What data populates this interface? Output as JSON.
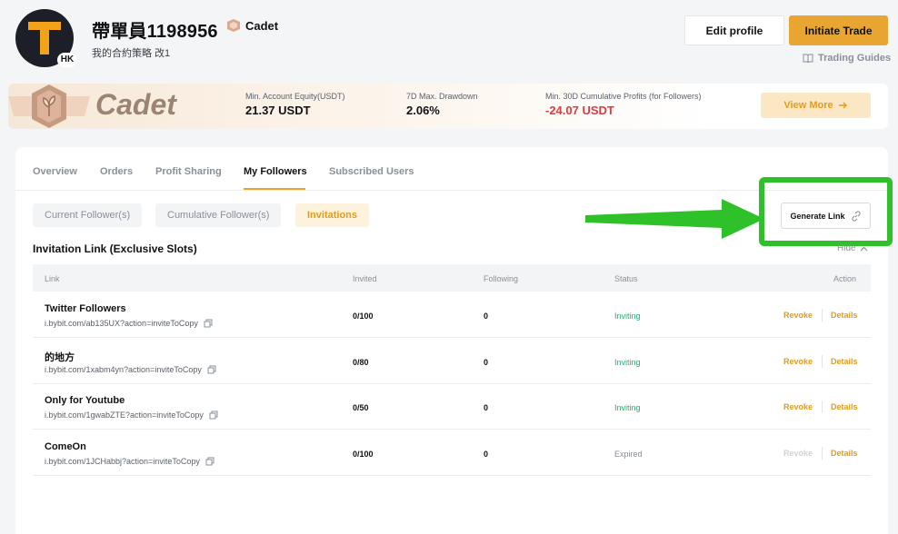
{
  "profile": {
    "name": "帶單員1198956",
    "rank": "Cadet",
    "bio": "我的合約策略 改1",
    "region": "HK",
    "avatar_letter": "T"
  },
  "header": {
    "edit_label": "Edit profile",
    "trade_label": "Initiate Trade",
    "guides_label": "Trading Guides"
  },
  "banner": {
    "rank_title": "Cadet",
    "stats": [
      {
        "label": "Min. Account Equity(USDT)",
        "value": "21.37 USDT"
      },
      {
        "label": "7D Max. Drawdown",
        "value": "2.06%"
      },
      {
        "label": "Min. 30D Cumulative Profits (for Followers)",
        "value": "-24.07 USDT"
      }
    ],
    "view_more": "View More"
  },
  "tabs": [
    "Overview",
    "Orders",
    "Profit Sharing",
    "My Followers",
    "Subscribed Users"
  ],
  "active_tab": "My Followers",
  "chips": [
    "Current Follower(s)",
    "Cumulative Follower(s)",
    "Invitations"
  ],
  "generate_link_label": "Generate Link",
  "section": {
    "title": "Invitation Link (Exclusive Slots)",
    "hide_label": "Hide"
  },
  "table": {
    "headers": {
      "link": "Link",
      "invited": "Invited",
      "following": "Following",
      "status": "Status",
      "action": "Action"
    },
    "rows": [
      {
        "name": "Twitter Followers",
        "url": "i.bybit.com/ab135UX?action=inviteToCopy",
        "invited": "0/100",
        "following": "0",
        "status": "Inviting",
        "revoke": "Revoke",
        "details": "Details"
      },
      {
        "name": "的地方",
        "url": "i.bybit.com/1xabm4yn?action=inviteToCopy",
        "invited": "0/80",
        "following": "0",
        "status": "Inviting",
        "revoke": "Revoke",
        "details": "Details"
      },
      {
        "name": "Only for Youtube",
        "url": "i.bybit.com/1gwabZTE?action=inviteToCopy",
        "invited": "0/50",
        "following": "0",
        "status": "Inviting",
        "revoke": "Revoke",
        "details": "Details"
      },
      {
        "name": "ComeOn",
        "url": "i.bybit.com/1JCHabbj?action=inviteToCopy",
        "invited": "0/100",
        "following": "0",
        "status": "Expired",
        "revoke": "Revoke",
        "details": "Details"
      }
    ]
  },
  "colors": {
    "accent": "#e8a531",
    "positive": "#20b26c",
    "negative": "#e03a3e",
    "highlight": "#2fc12a"
  }
}
